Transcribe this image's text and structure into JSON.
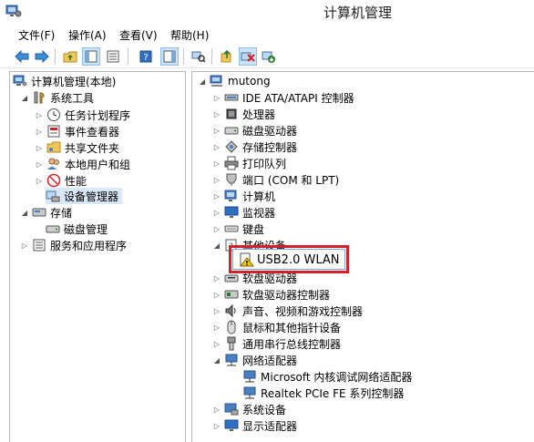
{
  "window": {
    "title": "计算机管理"
  },
  "menu": [
    "文件(F)",
    "操作(A)",
    "查看(V)",
    "帮助(H)"
  ],
  "left_tree": {
    "root": "计算机管理(本地)",
    "system_tools": "系统工具",
    "task_scheduler": "任务计划程序",
    "event_viewer": "事件查看器",
    "shared_folders": "共享文件夹",
    "local_users": "本地用户和组",
    "performance": "性能",
    "device_manager": "设备管理器",
    "storage": "存储",
    "disk_management": "磁盘管理",
    "services": "服务和应用程序"
  },
  "right_tree": {
    "root": "mutong",
    "items": [
      "IDE ATA/ATAPI 控制器",
      "处理器",
      "磁盘驱动器",
      "存储控制器",
      "打印队列",
      "端口 (COM 和 LPT)",
      "计算机",
      "监视器",
      "键盘",
      "其他设备"
    ],
    "other_child": "USB2.0 WLAN",
    "items2": [
      "软盘驱动器",
      "软盘驱动器控制器",
      "声音、视频和游戏控制器",
      "鼠标和其他指针设备",
      "通用串行总线控制器",
      "网络适配器"
    ],
    "network_children": [
      "Microsoft 内核调试网络适配器",
      "Realtek PCIe FE 系列控制器"
    ],
    "items3": [
      "系统设备",
      "显示适配器"
    ]
  },
  "colors": {
    "highlight_border": "#d3212a",
    "selection": "#d9e8f8"
  }
}
